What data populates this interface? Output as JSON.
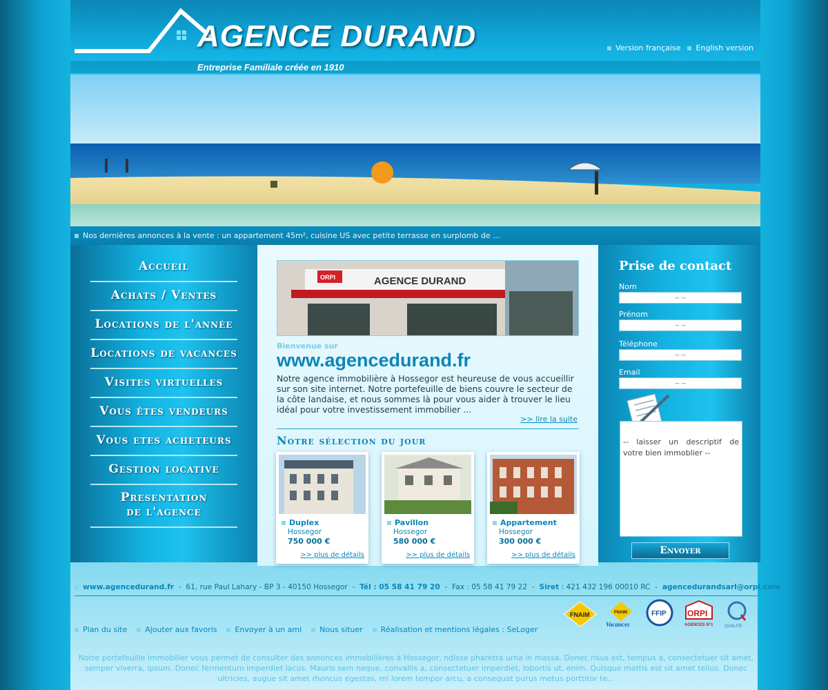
{
  "header": {
    "logo_title": "AGENCE DURAND",
    "tagline": "Entreprise Familiale créée en 1910",
    "lang_fr": "Version française",
    "lang_en": "English version"
  },
  "ticker": "Nos dernières annonces à la vente : un appartement 45m², cuisine US avec petite terrasse en surplomb de ...",
  "nav": {
    "items": [
      "Accueil",
      "Achats / Ventes",
      "Locations de l'année",
      "Locations de vacances",
      "Visites virtuelles",
      "Vous êtes vendeurs",
      "Vous etes acheteurs",
      "Gestion locative"
    ],
    "last_line1": "Presentation",
    "last_line2": "de l'agence"
  },
  "center": {
    "shop_sign": "AGENCE DURAND",
    "shop_brand": "ORPI",
    "welcome_small": "Bienvenue sur",
    "welcome_big": "www.agencedurand.fr",
    "intro": "Notre agence immobilière à Hossegor est heureuse de vous accueillir sur son site internet. Notre portefeuille de biens couvre le secteur de la côte landaise, et nous sommes là pour vous aider à trouver le lieu idéal pour votre investissement immobilier ...",
    "read_more": ">> lire la suite",
    "selection_title": "Notre sélection du jour",
    "cards": [
      {
        "title": "Duplex",
        "city": "Hossegor",
        "price": "750 000 €",
        "more": ">> plus de détails"
      },
      {
        "title": "Pavillon",
        "city": "Hossegor",
        "price": "580 000 €",
        "more": ">> plus de détails"
      },
      {
        "title": "Appartement",
        "city": "Hossegor",
        "price": "300 000 €",
        "more": ">> plus de détails"
      }
    ]
  },
  "contact": {
    "title": "Prise de contact",
    "nom_label": "Nom",
    "prenom_label": "Prénom",
    "tel_label": "Téléphone",
    "email_label": "Email",
    "field_value": "-- --",
    "desc_placeholder": "-- laisser un descriptif de votre bien immoblier --",
    "send": "Envoyer"
  },
  "footer": {
    "site": "www.agencedurand.fr",
    "address": "61, rue Paul Lahary - BP 3 - 40150 Hossegor",
    "tel": "Tél : 05 58 41 79 20",
    "fax": "Fax : 05 58 41 79 22",
    "siret_label": "Siret",
    "siret": ": 421 432 196 00010 RC",
    "email": "agencedurandsarl@orpi.com",
    "links": [
      "Plan du site",
      "Ajouter aux favoris",
      "Envoyer à un ami",
      "Nous situer",
      "Réalisation et mentions légales : SeLoger"
    ],
    "logos": {
      "fnaim": "FNAIM",
      "fnaim_vac": "FNAIM",
      "fnaim_vac2": "Vacances",
      "ffip": "FFIP",
      "orpi": "ORPI",
      "orpi_sub": "AGENCES N°1",
      "qualite": "QUALITE"
    },
    "text": "Notre portefeuille immobilier vous permet de consulter des annonces immobilières à  Hossegor, ndisse pharetra urna in massa. Donec risus est, tempus a, consectetuer sit amet, semper viverra, ipsum. Donec fermentum imperdiet lacus. Mauris sem neque, convallis a, consectetuer imperdiet, lobortis ut, enim. Quisque mattis est sit amet tellus. Donec ultricies, augue sit amet rhoncus egestas, mi lorem tempor arcu, a consequat purus metus porttitor te..."
  },
  "colors": {
    "accent": "#0a86b8",
    "light": "#1ec2ee"
  }
}
